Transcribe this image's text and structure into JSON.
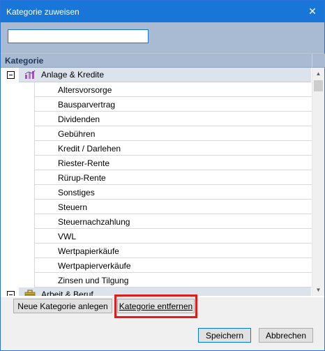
{
  "window": {
    "title": "Kategorie zuweisen"
  },
  "search": {
    "value": "",
    "placeholder": ""
  },
  "tree": {
    "column_header": "Kategorie",
    "groups": [
      {
        "label": "Anlage & Kredite",
        "icon": "chart-bars-icon",
        "expanded": true,
        "children": [
          "Altersvorsorge",
          "Bausparvertrag",
          "Dividenden",
          "Gebühren",
          "Kredit / Darlehen",
          "Riester-Rente",
          "Rürup-Rente",
          "Sonstiges",
          "Steuern",
          "Steuernachzahlung",
          "VWL",
          "Wertpapierkäufe",
          "Wertpapierverkäufe",
          "Zinsen und Tilgung"
        ]
      },
      {
        "label": "Arbeit & Beruf",
        "icon": "briefcase-icon",
        "expanded": true,
        "children": []
      }
    ]
  },
  "buttons": {
    "new_category": "Neue Kategorie anlegen",
    "remove_category": "Kategorie entfernen",
    "save": "Speichern",
    "cancel": "Abbrechen"
  },
  "colors": {
    "titlebar": "#1976d9",
    "header": "#a9bad3",
    "group_row": "#dce3ed",
    "highlight_frame": "#e21b1b",
    "anlage_icon": "#9b59b6",
    "arbeit_icon": "#c9a227"
  }
}
